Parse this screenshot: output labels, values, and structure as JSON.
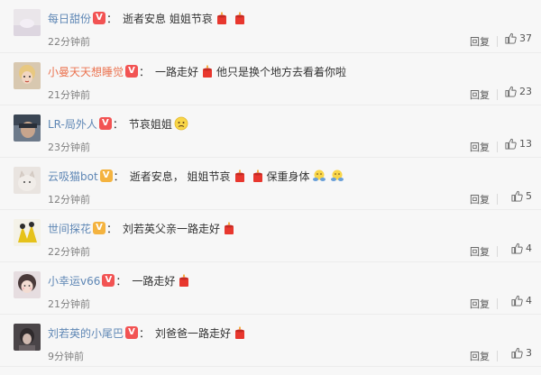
{
  "comments": [
    {
      "user": "每日甜份",
      "badge": "V",
      "badge_color": "red",
      "text_parts": [
        "逝者安息 姐姐节哀"
      ],
      "emojis": [
        "candle",
        "candle"
      ],
      "time": "22分钟前",
      "reply": "回复",
      "likes": "37"
    },
    {
      "user": "小曼天天想睡觉",
      "badge": "V",
      "badge_color": "red",
      "text_parts": [
        "一路走好",
        "他只是换个地方去看着你啦"
      ],
      "emojis": [
        "candle"
      ],
      "time": "21分钟前",
      "reply": "回复",
      "likes": "23"
    },
    {
      "user": "LR-局外人",
      "badge": "V",
      "badge_color": "red",
      "text_parts": [
        "节哀姐姐"
      ],
      "emojis": [
        "sad"
      ],
      "time": "23分钟前",
      "reply": "回复",
      "likes": "13"
    },
    {
      "user": "云吸猫bot",
      "badge": "V",
      "badge_color": "gold",
      "text_parts": [
        "逝者安息， 姐姐节哀",
        "保重身体"
      ],
      "emojis": [
        "candle",
        "candle",
        "hug",
        "hug"
      ],
      "time": "12分钟前",
      "reply": "回复",
      "likes": "5"
    },
    {
      "user": "世间探花",
      "badge": "V",
      "badge_color": "gold",
      "text_parts": [
        "刘若英父亲一路走好"
      ],
      "emojis": [
        "candle"
      ],
      "time": "22分钟前",
      "reply": "回复",
      "likes": "4"
    },
    {
      "user": "小幸运v66",
      "badge": "V",
      "badge_color": "red",
      "text_parts": [
        "一路走好"
      ],
      "emojis": [
        "candle"
      ],
      "time": "21分钟前",
      "reply": "回复",
      "likes": "4"
    },
    {
      "user": "刘若英的小尾巴",
      "badge": "V",
      "badge_color": "red",
      "text_parts": [
        "刘爸爸一路走好"
      ],
      "emojis": [
        "candle"
      ],
      "time": "9分钟前",
      "reply": "回复",
      "likes": "3"
    }
  ],
  "colors": {
    "username": "#eb7350",
    "username_alt": "#5f87b5",
    "badge_red": "#f25353",
    "badge_gold": "#f4b33f",
    "candle": "#e8372e"
  }
}
